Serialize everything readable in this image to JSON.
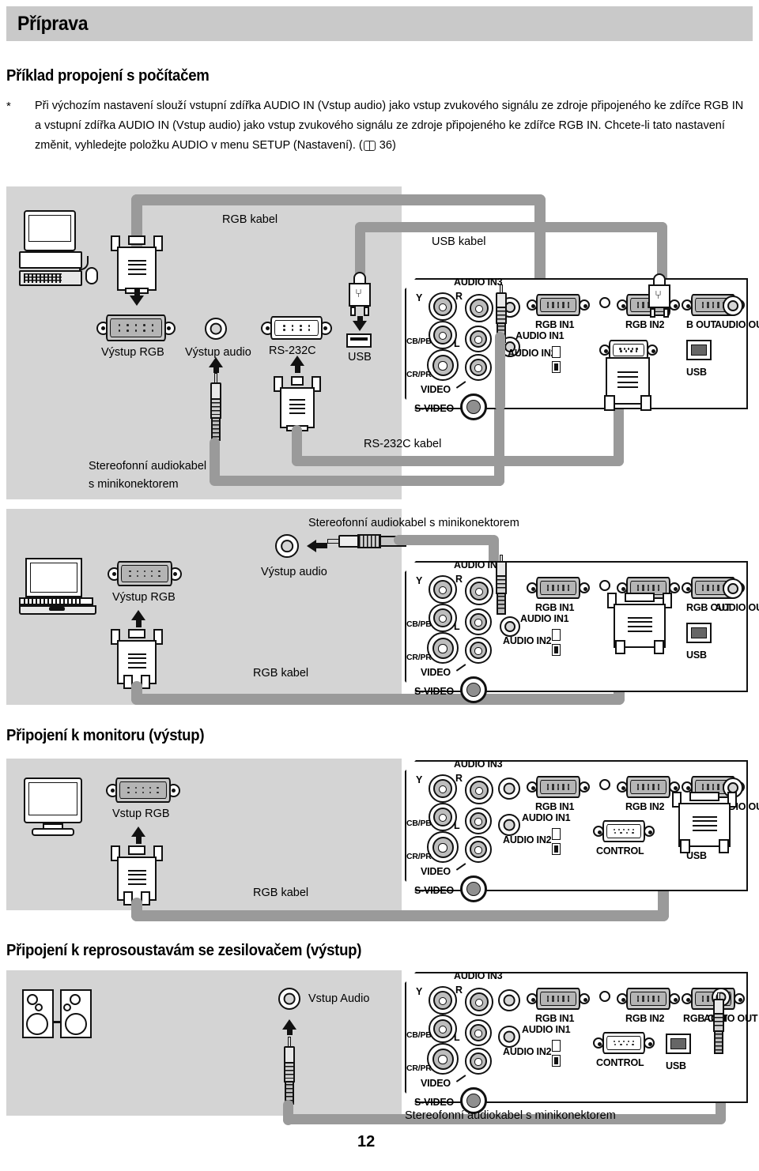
{
  "header": {
    "chapter": "Příprava"
  },
  "sections": {
    "computer": {
      "title": "Příklad propojení s počítačem",
      "note_star": "*",
      "note_text": "Při výchozím nastavení slouží vstupní zdířka AUDIO IN (Vstup audio) jako vstup zvukového signálu ze zdroje připojeného ke zdířce RGB IN a vstupní zdířka AUDIO IN (Vstup audio) jako vstup zvukového signálu ze zdroje připojeného ke zdířce RGB IN. Chcete-li tato nastavení změnit, vyhledejte položku AUDIO v menu SETUP (Nastavení). (",
      "note_page": "36",
      "note_tail": ")"
    },
    "monitor": {
      "title": "Připojení k monitoru (výstup)"
    },
    "speakers": {
      "title": "Připojení k reprosoustavám se zesilovačem (výstup)"
    }
  },
  "diagram1": {
    "cables": {
      "rgb": "RGB kabel",
      "usb": "USB kabel",
      "rs232": "RS-232C kabel",
      "audio_l1": "Stereofonní audiokabel",
      "audio_l2": "s minikonektorem"
    },
    "ports": {
      "rgb_out": "Výstup RGB",
      "audio_out": "Výstup audio",
      "rs232c": "RS-232C",
      "usb": "USB"
    }
  },
  "diagram2": {
    "cables": {
      "audio": "Stereofonní audiokabel s minikonektorem",
      "rgb": "RGB kabel"
    },
    "ports": {
      "rgb_out": "Výstup RGB",
      "audio_out": "Výstup audio"
    }
  },
  "diagram3": {
    "cables": {
      "rgb": "RGB kabel"
    },
    "ports": {
      "rgb_in": "Vstup RGB"
    }
  },
  "diagram4": {
    "ports": {
      "audio_in": "Vstup Audio"
    },
    "cables": {
      "audio": "Stereofonní audiokabel s minikonektorem"
    }
  },
  "panel_labels": {
    "y": "Y",
    "cb_pb": "CB/PB",
    "cr_pr": "CR/PR",
    "r": "R",
    "l": "L",
    "audio_in3": "AUDIO IN3",
    "audio_in1": "AUDIO IN1",
    "audio_in2": "AUDIO IN2",
    "video": "VIDEO",
    "svideo": "S-VIDEO",
    "rgb_in1": "RGB IN1",
    "rgb_in2": "RGB IN2",
    "rgb_out": "RGB OUT",
    "audio_out": "AUDIO OUT",
    "control": "CONTROL",
    "usb": "USB",
    "rgb_out_clipped": "B OUT"
  },
  "footer": {
    "page": "12",
    "caption": "Stereofonní audiokabel s minikonektorem"
  },
  "colors": {
    "header_gray": "#c9c9c9",
    "panel_gray": "#d4d4d4",
    "cable_gray": "#9a9a9a",
    "ink": "#111111"
  }
}
